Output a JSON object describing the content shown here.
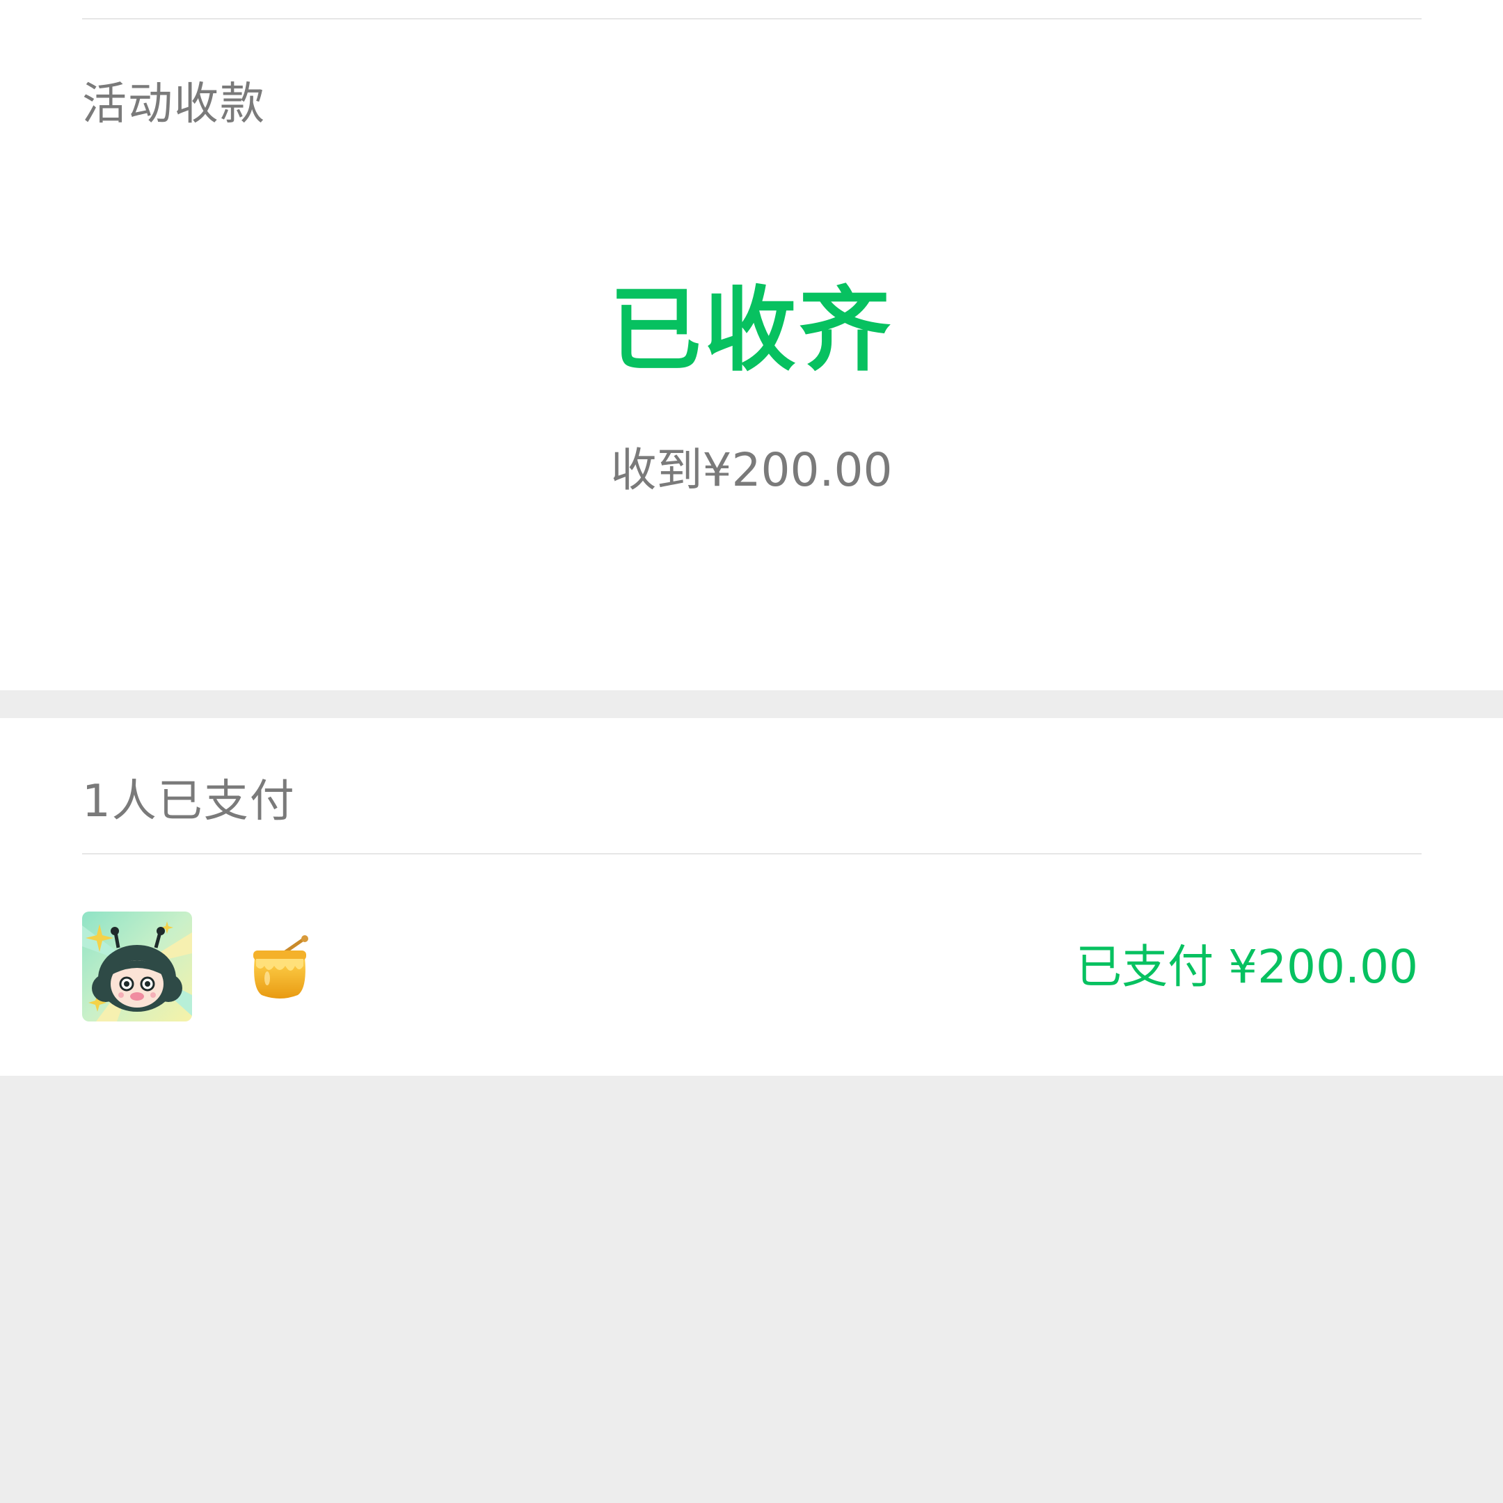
{
  "activity": {
    "title": "活动收款"
  },
  "summary": {
    "status": "已收齐",
    "received": "收到¥200.00"
  },
  "payers": {
    "count_label": "1人已支付",
    "items": [
      {
        "avatar": "cartoon-girl-avatar",
        "name_icon": "honey-pot-icon",
        "status": "已支付 ¥200.00"
      }
    ]
  },
  "colors": {
    "accent": "#07c160",
    "muted_text": "#7a7a7a",
    "background": "#ededed",
    "card": "#ffffff"
  }
}
